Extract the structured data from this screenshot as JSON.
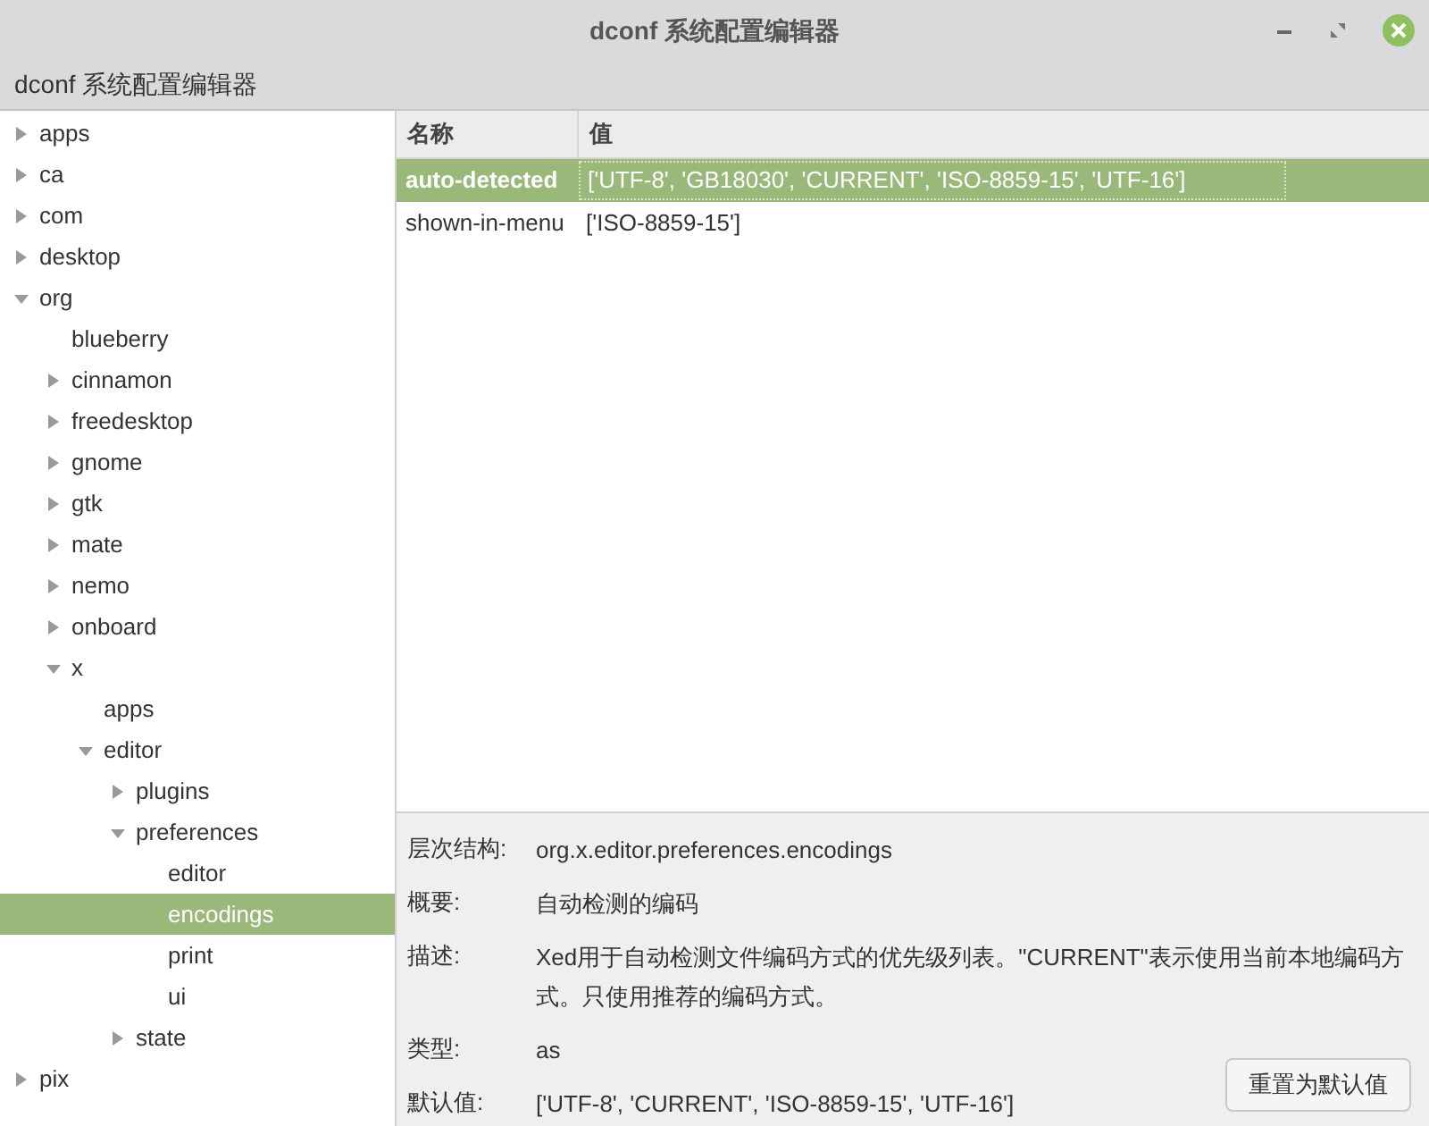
{
  "window": {
    "title": "dconf 系统配置编辑器"
  },
  "header": {
    "title": "dconf 系统配置编辑器"
  },
  "tree": [
    {
      "label": "apps",
      "kind": "branch",
      "expanded": false,
      "selected": false
    },
    {
      "label": "ca",
      "kind": "branch",
      "expanded": false,
      "selected": false
    },
    {
      "label": "com",
      "kind": "branch",
      "expanded": false,
      "selected": false
    },
    {
      "label": "desktop",
      "kind": "branch",
      "expanded": false,
      "selected": false
    },
    {
      "label": "org",
      "kind": "branch",
      "expanded": true,
      "selected": false,
      "children": [
        {
          "label": "blueberry",
          "kind": "leaf",
          "selected": false
        },
        {
          "label": "cinnamon",
          "kind": "branch",
          "expanded": false,
          "selected": false
        },
        {
          "label": "freedesktop",
          "kind": "branch",
          "expanded": false,
          "selected": false
        },
        {
          "label": "gnome",
          "kind": "branch",
          "expanded": false,
          "selected": false
        },
        {
          "label": "gtk",
          "kind": "branch",
          "expanded": false,
          "selected": false
        },
        {
          "label": "mate",
          "kind": "branch",
          "expanded": false,
          "selected": false
        },
        {
          "label": "nemo",
          "kind": "branch",
          "expanded": false,
          "selected": false
        },
        {
          "label": "onboard",
          "kind": "branch",
          "expanded": false,
          "selected": false
        },
        {
          "label": "x",
          "kind": "branch",
          "expanded": true,
          "selected": false,
          "children": [
            {
              "label": "apps",
              "kind": "leaf",
              "selected": false
            },
            {
              "label": "editor",
              "kind": "branch",
              "expanded": true,
              "selected": false,
              "children": [
                {
                  "label": "plugins",
                  "kind": "branch",
                  "expanded": false,
                  "selected": false
                },
                {
                  "label": "preferences",
                  "kind": "branch",
                  "expanded": true,
                  "selected": false,
                  "children": [
                    {
                      "label": "editor",
                      "kind": "leaf",
                      "selected": false
                    },
                    {
                      "label": "encodings",
                      "kind": "leaf",
                      "selected": true
                    },
                    {
                      "label": "print",
                      "kind": "leaf",
                      "selected": false
                    },
                    {
                      "label": "ui",
                      "kind": "leaf",
                      "selected": false
                    }
                  ]
                },
                {
                  "label": "state",
                  "kind": "branch",
                  "expanded": false,
                  "selected": false
                }
              ]
            }
          ]
        }
      ]
    },
    {
      "label": "pix",
      "kind": "branch",
      "expanded": false,
      "selected": false
    }
  ],
  "table": {
    "columns": [
      "名称",
      "值"
    ],
    "rows": [
      {
        "name": "auto-detected",
        "value": "['UTF-8', 'GB18030', 'CURRENT', 'ISO-8859-15', 'UTF-16']",
        "selected": true
      },
      {
        "name": "shown-in-menu",
        "value": "['ISO-8859-15']",
        "selected": false
      }
    ]
  },
  "details": [
    {
      "label": "层次结构:",
      "value": "org.x.editor.preferences.encodings"
    },
    {
      "label": "概要:",
      "value": "自动检测的编码"
    },
    {
      "label": "描述:",
      "value": "Xed用于自动检测文件编码方式的优先级列表。\"CURRENT\"表示使用当前本地编码方式。只使用推荐的编码方式。"
    },
    {
      "label": "类型:",
      "value": "as"
    },
    {
      "label": "默认值:",
      "value": "['UTF-8', 'CURRENT', 'ISO-8859-15', 'UTF-16']"
    }
  ],
  "reset_button": "重置为默认值"
}
